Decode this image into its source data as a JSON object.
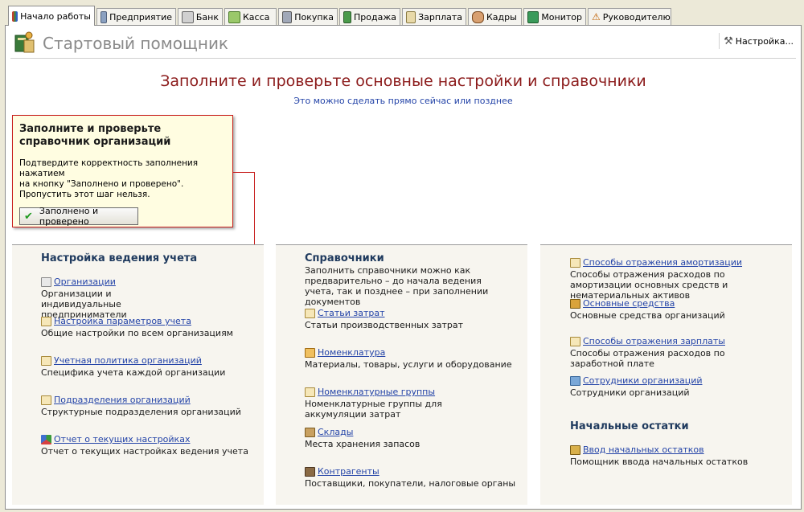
{
  "tabs": [
    {
      "label": "Начало работы",
      "icon": "start-icon",
      "active": true
    },
    {
      "label": "Предприятие",
      "icon": "enterprise-icon"
    },
    {
      "label": "Банк",
      "icon": "bank-icon"
    },
    {
      "label": "Касса",
      "icon": "cash-icon"
    },
    {
      "label": "Покупка",
      "icon": "purchase-icon"
    },
    {
      "label": "Продажа",
      "icon": "sale-icon"
    },
    {
      "label": "Зарплата",
      "icon": "salary-icon"
    },
    {
      "label": "Кадры",
      "icon": "staff-icon"
    },
    {
      "label": "Монитор",
      "icon": "monitor-icon"
    },
    {
      "label": "Руководителю",
      "icon": "warning-icon"
    }
  ],
  "header": {
    "title": "Стартовый помощник",
    "settings_label": "Настройка..."
  },
  "main": {
    "title": "Заполните и проверьте основные настройки и справочники",
    "subtitle": "Это можно сделать прямо сейчас или позднее"
  },
  "popup": {
    "title": "Заполните и проверьте справочник организаций",
    "text_line1": "Подтвердите корректность заполнения нажатием",
    "text_line2": "на кнопку \"Заполнено и проверено\".",
    "text_line3": "Пропустить этот шаг нельзя.",
    "button_label": "Заполнено и проверено"
  },
  "col1": {
    "heading": "Настройка ведения учета",
    "items": [
      {
        "link": "Организации",
        "desc": "Организации и индивидуальные предприниматели",
        "icon": "clipboard-icon"
      },
      {
        "link": "Настройка параметров учета",
        "desc": "Общие настройки по всем организациям",
        "icon": "document-icon"
      },
      {
        "link": "Учетная политика организаций",
        "desc": "Специфика учета каждой организации",
        "icon": "document-icon"
      },
      {
        "link": "Подразделения организаций",
        "desc": "Структурные подразделения организаций",
        "icon": "document-icon"
      },
      {
        "link": "Отчет о текущих настройках",
        "desc": "Отчет о текущих настройках ведения учета",
        "icon": "report-icon"
      }
    ]
  },
  "col2": {
    "heading": "Справочники",
    "intro": "Заполнить справочники можно как предварительно – до начала ведения учета, так и позднее – при заполнении документов",
    "items": [
      {
        "link": "Статьи затрат",
        "desc": "Статьи производственных затрат",
        "icon": "document-icon"
      },
      {
        "link": "Номенклатура",
        "desc": "Материалы, товары, услуги и оборудование",
        "icon": "nomenclature-icon"
      },
      {
        "link": "Номенклатурные группы",
        "desc": "Номенклатурные группы для аккумуляции затрат",
        "icon": "document-icon"
      },
      {
        "link": "Склады",
        "desc": "Места хранения запасов",
        "icon": "warehouse-icon"
      },
      {
        "link": "Контрагенты",
        "desc": "Поставщики, покупатели, налоговые органы",
        "icon": "briefcase-icon"
      }
    ]
  },
  "col3": {
    "items": [
      {
        "link": "Способы отражения амортизации",
        "desc": "Способы отражения расходов по амортизации основных средств и нематериальных активов",
        "icon": "document-icon"
      },
      {
        "link": "Основные средства",
        "desc": "Основные средства организаций",
        "icon": "truck-icon"
      },
      {
        "link": "Способы отражения зарплаты",
        "desc": "Способы отражения расходов по заработной плате",
        "icon": "document-icon"
      },
      {
        "link": "Сотрудники организаций",
        "desc": "Сотрудники организаций",
        "icon": "employee-icon"
      }
    ],
    "heading2": "Начальные остатки",
    "balances": {
      "link": "Ввод начальных остатков",
      "desc": "Помощник ввода начальных остатков",
      "icon": "balances-icon"
    }
  }
}
